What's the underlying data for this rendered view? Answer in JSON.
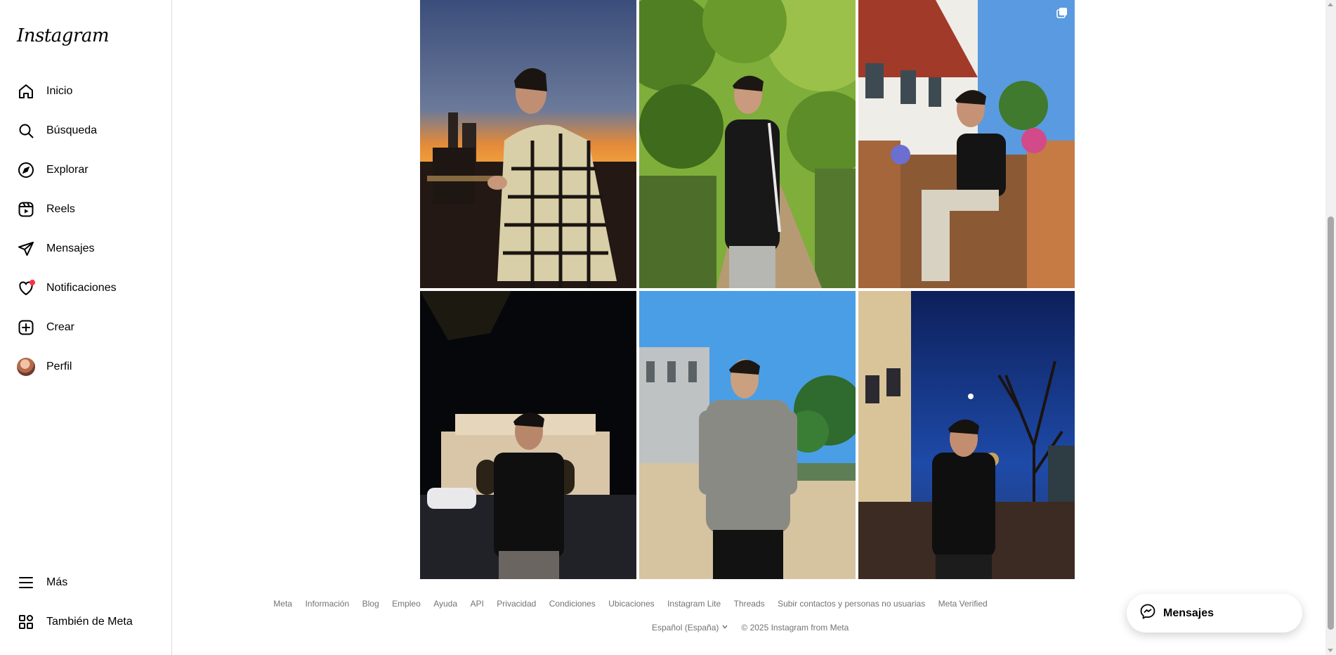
{
  "app": {
    "logo": "Instagram"
  },
  "sidebar": {
    "items": [
      {
        "label": "Inicio",
        "icon": "home-icon"
      },
      {
        "label": "Búsqueda",
        "icon": "search-icon"
      },
      {
        "label": "Explorar",
        "icon": "compass-icon"
      },
      {
        "label": "Reels",
        "icon": "reels-icon"
      },
      {
        "label": "Mensajes",
        "icon": "messages-icon"
      },
      {
        "label": "Notificaciones",
        "icon": "heart-icon",
        "has_dot": true
      },
      {
        "label": "Crear",
        "icon": "create-icon"
      },
      {
        "label": "Perfil",
        "icon": "avatar"
      }
    ],
    "bottom": [
      {
        "label": "Más",
        "icon": "menu-icon"
      },
      {
        "label": "También de Meta",
        "icon": "meta-apps-icon"
      }
    ]
  },
  "posts": [
    {
      "scene": "night-city-plaid",
      "carousel": false
    },
    {
      "scene": "park-tracksuit",
      "carousel": false
    },
    {
      "scene": "terrace-chair",
      "carousel": true
    },
    {
      "scene": "night-arch",
      "carousel": false
    },
    {
      "scene": "palace-sunny",
      "carousel": false
    },
    {
      "scene": "night-street-tree",
      "carousel": false
    }
  ],
  "footer": {
    "links": [
      "Meta",
      "Información",
      "Blog",
      "Empleo",
      "Ayuda",
      "API",
      "Privacidad",
      "Condiciones",
      "Ubicaciones",
      "Instagram Lite",
      "Threads",
      "Subir contactos y personas no usuarias",
      "Meta Verified"
    ],
    "language": "Español (España)",
    "copyright": "© 2025 Instagram from Meta"
  },
  "messages_pill": {
    "label": "Mensajes"
  },
  "colors": {
    "notification_dot": "#ff3040",
    "border": "#dbdbdb",
    "muted_text": "#737373"
  }
}
